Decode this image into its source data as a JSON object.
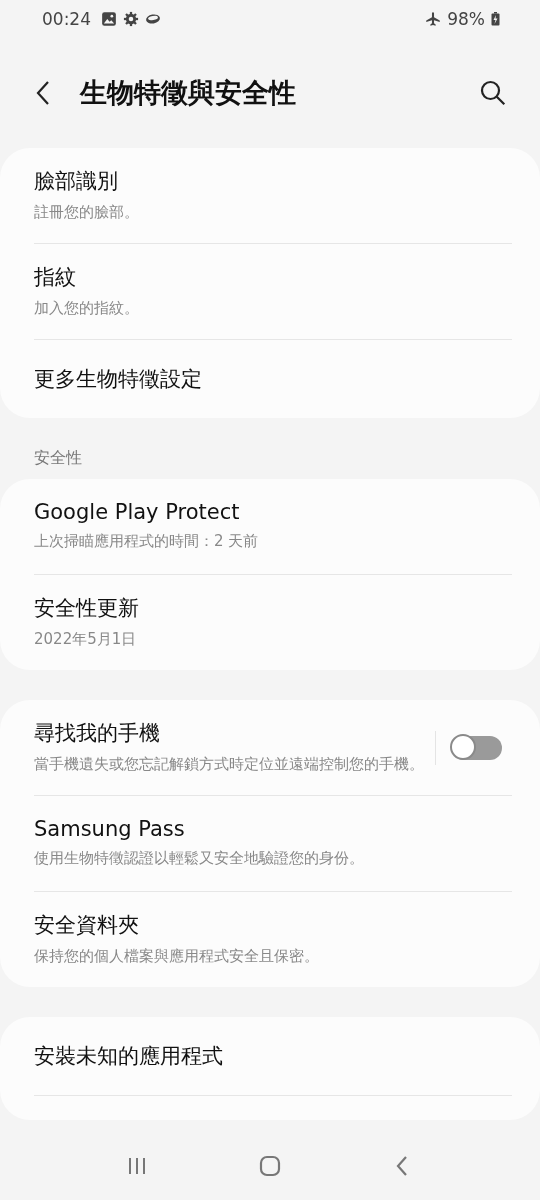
{
  "status_bar": {
    "time": "00:24",
    "battery": "98%"
  },
  "header": {
    "title": "生物特徵與安全性"
  },
  "groups": [
    {
      "items": [
        {
          "kind": "link",
          "title": "臉部識別",
          "subtitle": "註冊您的臉部。"
        },
        {
          "kind": "link",
          "title": "指紋",
          "subtitle": "加入您的指紋。"
        },
        {
          "kind": "link",
          "title": "更多生物特徵設定"
        }
      ]
    },
    {
      "heading": "安全性",
      "items": [
        {
          "kind": "link",
          "title": "Google Play Protect",
          "subtitle": "上次掃瞄應用程式的時間：2 天前"
        },
        {
          "kind": "link",
          "title": "安全性更新",
          "subtitle": "2022年5月1日"
        }
      ]
    },
    {
      "items": [
        {
          "kind": "toggle",
          "title": "尋找我的手機",
          "subtitle": "當手機遺失或您忘記解鎖方式時定位並遠端控制您的手機。",
          "on": false
        },
        {
          "kind": "link",
          "title": "Samsung Pass",
          "subtitle": "使用生物特徵認證以輕鬆又安全地驗證您的身份。"
        },
        {
          "kind": "link",
          "title": "安全資料夾",
          "subtitle": "保持您的個人檔案與應用程式安全且保密。"
        }
      ]
    },
    {
      "continues": true,
      "items": [
        {
          "kind": "link",
          "title": "安裝未知的應用程式"
        }
      ]
    }
  ]
}
